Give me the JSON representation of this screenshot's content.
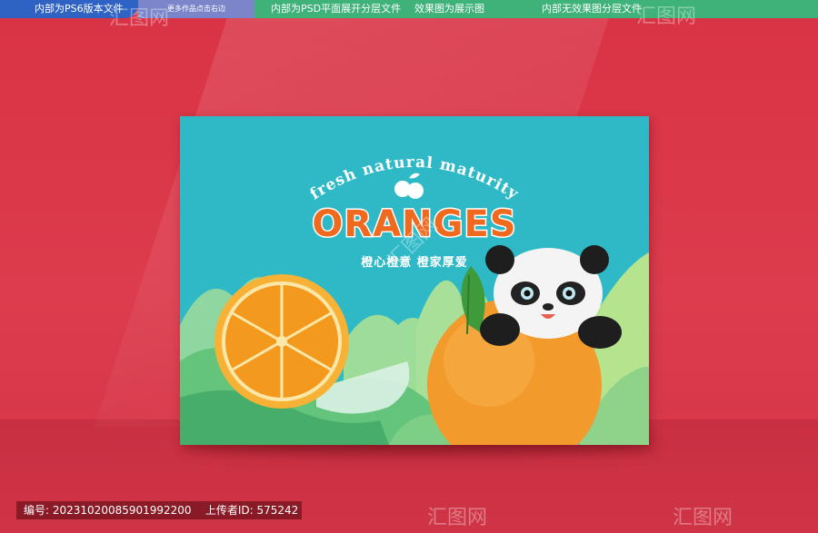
{
  "topbar": {
    "seg1": "内部为PS6版本文件",
    "seg2": "更多作品点击右边",
    "seg3a": "内部为PSD平面展开分层文件",
    "seg3b": "效果图为展示图",
    "seg3c": "内部无效果图分层文件"
  },
  "box": {
    "tagline": "fresh natural maturity",
    "title": "ORANGES",
    "subtitle": "橙心橙意 橙家厚爱"
  },
  "footer": {
    "label_id": "编号:",
    "id": "20231020085901992200",
    "label_uploader": "上传者ID:",
    "uploader": "575242"
  },
  "watermark": "汇图网",
  "colors": {
    "background": "#d9394a",
    "box": "#2fb9c7",
    "title": "#ef6a1e",
    "accent_blue": "#2e63c4",
    "accent_green": "#3fb27a"
  }
}
